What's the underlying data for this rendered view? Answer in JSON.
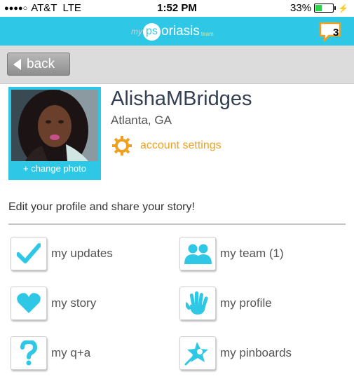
{
  "status_bar": {
    "signal_dots": "●●●●○",
    "carrier": "AT&T",
    "network": "LTE",
    "time": "1:52 PM",
    "battery_percent": "33%",
    "battery_level": 0.33
  },
  "header": {
    "logo_my": "my",
    "logo_ps": "ps",
    "logo_rest": "oriasis",
    "logo_team": "team",
    "notification_count": "3"
  },
  "nav": {
    "back_label": "back"
  },
  "profile": {
    "username": "AlishaMBridges",
    "location": "Atlanta, GA",
    "settings_label": "account settings",
    "change_photo_label": "+ change photo"
  },
  "tagline": "Edit your profile and share your story!",
  "menu": [
    {
      "label": "my updates",
      "icon": "checkmark-icon"
    },
    {
      "label": "my team (1)",
      "icon": "team-icon"
    },
    {
      "label": "my story",
      "icon": "heart-icon"
    },
    {
      "label": "my profile",
      "icon": "hand-icon"
    },
    {
      "label": "my q+a",
      "icon": "question-icon"
    },
    {
      "label": "my pinboards",
      "icon": "pinboard-icon"
    }
  ],
  "colors": {
    "brand": "#2ec8e6",
    "accent": "#f0a020",
    "battery": "#2dd34a"
  }
}
